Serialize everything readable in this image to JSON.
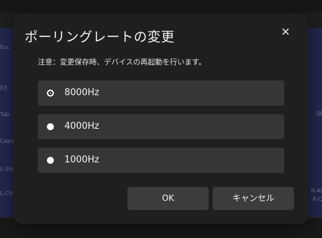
{
  "background": {
    "left_keys": [
      "Esc",
      "E/J",
      "Tab",
      "Caps",
      "L-Shi",
      "L-Ctr"
    ],
    "right_keys": [
      "@",
      "R-Al",
      "R-C"
    ]
  },
  "dialog": {
    "title": "ポーリングレートの変更",
    "close_glyph": "✕",
    "note": "注意：変更保存時、デバイスの再起動を行います。",
    "options": [
      {
        "label": "8000Hz",
        "selected": true
      },
      {
        "label": "4000Hz",
        "selected": false
      },
      {
        "label": "1000Hz",
        "selected": false
      }
    ],
    "ok_label": "OK",
    "cancel_label": "キャンセル"
  },
  "colors": {
    "dialog_bg": "#1f1f1f",
    "option_bg": "#363636",
    "button_bg": "#3c3c3c",
    "text": "#f2f2f2"
  }
}
